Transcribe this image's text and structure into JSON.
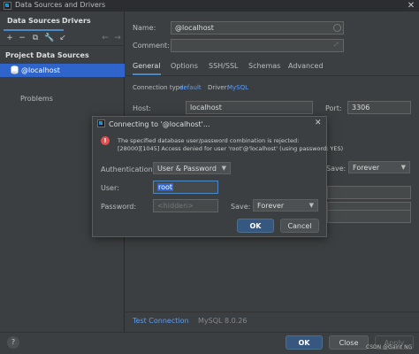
{
  "window": {
    "title": "Data Sources and Drivers",
    "close_glyph": "✕"
  },
  "left": {
    "tabs": [
      "Data Sources",
      "Drivers"
    ],
    "toolbar_icons": [
      "+",
      "−",
      "⧉",
      "🔧",
      "↙",
      "←",
      "→"
    ],
    "section_title": "Project Data Sources",
    "tree_item": "@localhost",
    "problems": "Problems"
  },
  "form": {
    "name_label": "Name:",
    "name_value": "@localhost",
    "comment_label": "Comment:",
    "comment_value": "",
    "tabs": [
      "General",
      "Options",
      "SSH/SSL",
      "Schemas",
      "Advanced"
    ],
    "connection_type_label": "Connection type:",
    "connection_type_value": "default",
    "driver_label": "Driver:",
    "driver_value": "MySQL",
    "host_label": "Host:",
    "host_value": "localhost",
    "port_label": "Port:",
    "port_value": "3306",
    "save_label": "Save:",
    "save_value": "Forever",
    "test_connection": "Test Connection",
    "mysql_version": "MySQL 8.0.26"
  },
  "footer": {
    "help": "?",
    "ok": "OK",
    "close": "Close",
    "apply": "Apply"
  },
  "watermark": "CSDN @Gaint NG",
  "dialog": {
    "title": "Connecting to '@localhost'...",
    "error_line1": "The specified database user/password combination is rejected:",
    "error_line2": "[28000][1045] Access denied for user 'root'@'localhost' (using password: YES)",
    "auth_label": "Authentication:",
    "auth_value": "User & Password",
    "user_label": "User:",
    "user_value": "root",
    "password_label": "Password:",
    "password_placeholder": "<hidden>",
    "save_label": "Save:",
    "save_value": "Forever",
    "ok": "OK",
    "cancel": "Cancel"
  },
  "colors": {
    "accent": "#2f65ca",
    "link": "#589df6",
    "error": "#e34f4f",
    "primary_button": "#365880"
  }
}
